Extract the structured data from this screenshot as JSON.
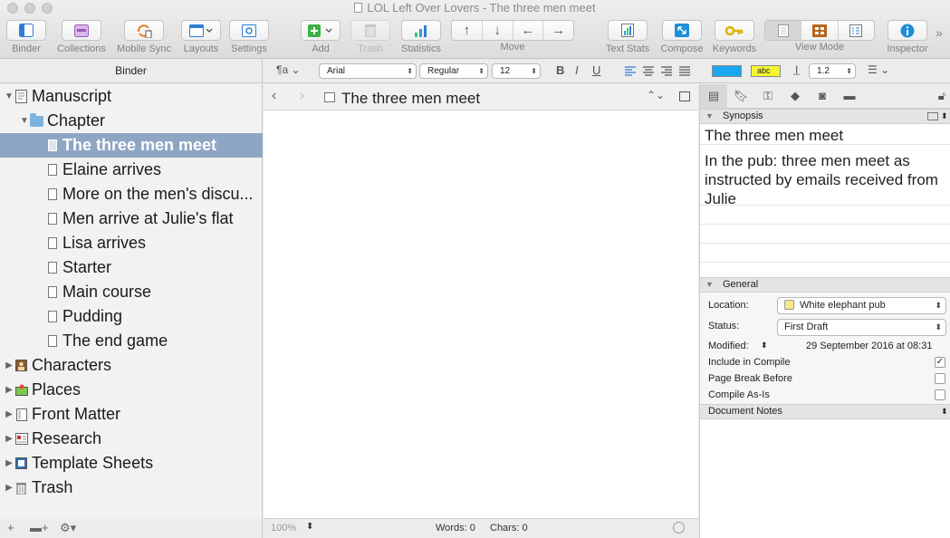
{
  "window": {
    "title": "LOL Left Over Lovers - The three men meet"
  },
  "toolbar": {
    "binder": "Binder",
    "collections": "Collections",
    "mobile_sync": "Mobile Sync",
    "layouts": "Layouts",
    "settings": "Settings",
    "add": "Add",
    "trash": "Trash",
    "statistics": "Statistics",
    "move": "Move",
    "text_stats": "Text Stats",
    "compose": "Compose",
    "keywords": "Keywords",
    "view_mode": "View Mode",
    "inspector": "Inspector",
    "move_arrows": [
      "↑",
      "↓",
      "←",
      "→"
    ]
  },
  "format_bar": {
    "binder_header": "Binder",
    "font": "Arial",
    "style": "Regular",
    "size": "12",
    "bold": "B",
    "italic": "I",
    "underline": "U",
    "highlight_label": "abc",
    "line_spacing": "1.2",
    "colors": {
      "text": "#1aa7f0",
      "highlight": "#f5f531"
    }
  },
  "binder": {
    "items": [
      {
        "label": "Manuscript",
        "level": 0,
        "disclosure": "open",
        "icon": "manuscript-icon"
      },
      {
        "label": "Chapter",
        "level": 1,
        "disclosure": "open",
        "icon": "folder-icon"
      },
      {
        "label": "The three men meet",
        "level": 2,
        "selected": true,
        "icon": "document-icon"
      },
      {
        "label": "Elaine arrives",
        "level": 2,
        "icon": "document-icon"
      },
      {
        "label": "More on the men's discu...",
        "level": 2,
        "icon": "document-icon"
      },
      {
        "label": "Men arrive at Julie's flat",
        "level": 2,
        "icon": "document-icon"
      },
      {
        "label": "Lisa arrives",
        "level": 2,
        "icon": "document-icon"
      },
      {
        "label": "Starter",
        "level": 2,
        "icon": "document-icon"
      },
      {
        "label": "Main course",
        "level": 2,
        "icon": "document-icon"
      },
      {
        "label": "Pudding",
        "level": 2,
        "icon": "document-icon"
      },
      {
        "label": "The end game",
        "level": 2,
        "icon": "document-icon"
      },
      {
        "label": "Characters",
        "level": 0,
        "disclosure": "closed",
        "icon": "characters-icon"
      },
      {
        "label": "Places",
        "level": 0,
        "disclosure": "closed",
        "icon": "places-icon"
      },
      {
        "label": "Front Matter",
        "level": 0,
        "disclosure": "closed",
        "icon": "front-matter-icon"
      },
      {
        "label": "Research",
        "level": 0,
        "disclosure": "closed",
        "icon": "research-icon"
      },
      {
        "label": "Template Sheets",
        "level": 0,
        "disclosure": "closed",
        "icon": "template-sheets-icon"
      },
      {
        "label": "Trash",
        "level": 0,
        "disclosure": "closed",
        "icon": "trash-icon"
      }
    ]
  },
  "editor": {
    "doc_title": "The three men meet",
    "zoom": "100%",
    "words": "Words: 0",
    "chars": "Chars: 0"
  },
  "inspector": {
    "synopsis_header": "Synopsis",
    "synopsis_title": "The three men meet",
    "synopsis_text": "In the pub: three men meet as instructed by emails received from Julie",
    "general_header": "General",
    "location_label": "Location:",
    "location_value": "White elephant pub",
    "location_color": "#f5e98a",
    "status_label": "Status:",
    "status_value": "First Draft",
    "modified_label": "Modified:",
    "modified_value": "29 September 2016 at 08:31",
    "include_label": "Include in Compile",
    "include_checked": true,
    "page_break_label": "Page Break Before",
    "page_break_checked": false,
    "compile_as_is_label": "Compile As-Is",
    "compile_as_is_checked": false,
    "document_notes_header": "Document Notes"
  }
}
